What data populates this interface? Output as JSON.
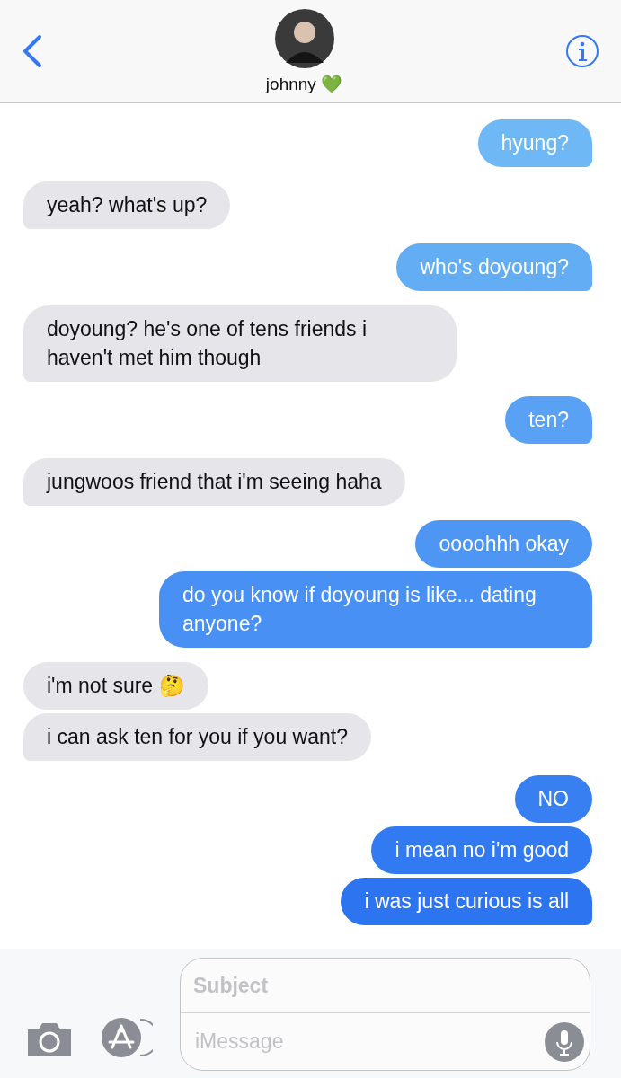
{
  "header": {
    "name": "johnny 💚"
  },
  "messages": [
    {
      "kind": "sent",
      "text": "hyung?",
      "tail": true
    },
    {
      "kind": "received",
      "text": "yeah? what's up?",
      "tail": true
    },
    {
      "kind": "sent",
      "text": "who's doyoung?",
      "tail": true
    },
    {
      "kind": "received",
      "text": "doyoung? he's one of tens friends i haven't met him though",
      "tail": true
    },
    {
      "kind": "sent",
      "text": "ten?",
      "tail": true
    },
    {
      "kind": "received",
      "text": "jungwoos friend that i'm seeing haha",
      "tail": true
    },
    {
      "kind": "sent",
      "text": "oooohhh okay",
      "tail": false
    },
    {
      "kind": "sent",
      "text": "do you know if doyoung is like... dating anyone?",
      "tail": true
    },
    {
      "kind": "received",
      "text": "i'm not sure 🤔",
      "tail": false
    },
    {
      "kind": "received",
      "text": "i can ask ten for you if you want?",
      "tail": true
    },
    {
      "kind": "sent",
      "text": "NO",
      "tail": false
    },
    {
      "kind": "sent",
      "text": "i mean no i'm good",
      "tail": false
    },
    {
      "kind": "sent",
      "text": "i was just curious is all",
      "tail": true
    }
  ],
  "composer": {
    "subject_placeholder": "Subject",
    "message_placeholder": "iMessage"
  }
}
